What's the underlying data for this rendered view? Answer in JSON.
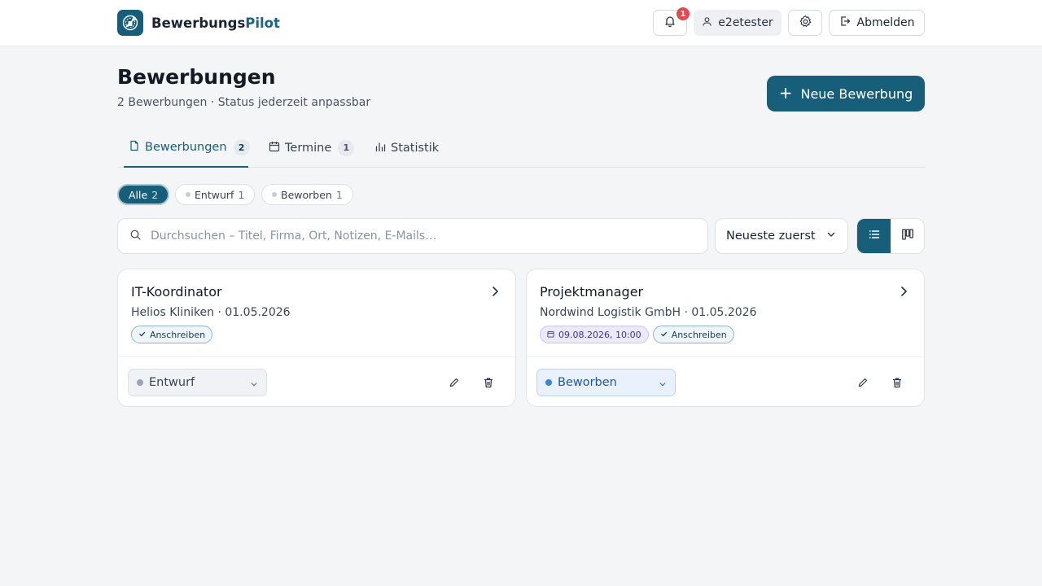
{
  "header": {
    "brand_part1": "Bewerbungs",
    "brand_part2": "Pilot",
    "notification_count": "1",
    "username": "e2etester",
    "logout_label": "Abmelden"
  },
  "page": {
    "title": "Bewerbungen",
    "subtitle": "2 Bewerbungen · Status jederzeit anpassbar",
    "new_button_label": "Neue Bewerbung"
  },
  "tabs": [
    {
      "label": "Bewerbungen",
      "count": "2",
      "icon": "file-icon",
      "active": true
    },
    {
      "label": "Termine",
      "count": "1",
      "icon": "calendar-icon",
      "active": false
    },
    {
      "label": "Statistik",
      "count": "",
      "icon": "bar-chart-icon",
      "active": false
    }
  ],
  "filters": [
    {
      "label": "Alle",
      "count": "2",
      "active": true
    },
    {
      "label": "Entwurf",
      "count": "1",
      "active": false
    },
    {
      "label": "Beworben",
      "count": "1",
      "active": false
    }
  ],
  "search": {
    "placeholder": "Durchsuchen – Titel, Firma, Ort, Notizen, E-Mails…",
    "value": ""
  },
  "sort": {
    "selected": "Neueste zuerst"
  },
  "view_toggle": {
    "active": "list"
  },
  "applications": [
    {
      "title": "IT-Koordinator",
      "company_date": "Helios Kliniken · 01.05.2026",
      "date_tag": "",
      "tag": "Anschreiben",
      "status": "Entwurf"
    },
    {
      "title": "Projektmanager",
      "company_date": "Nordwind Logistik GmbH · 01.05.2026",
      "date_tag": "09.08.2026, 10:00",
      "tag": "Anschreiben",
      "status": "Beworben"
    }
  ],
  "colors": {
    "primary": "#175e7a",
    "background": "#f3f5f7",
    "badge": "#e5484d",
    "status_draft_dot": "#9aa3b0",
    "status_applied_dot": "#3b82e6"
  }
}
